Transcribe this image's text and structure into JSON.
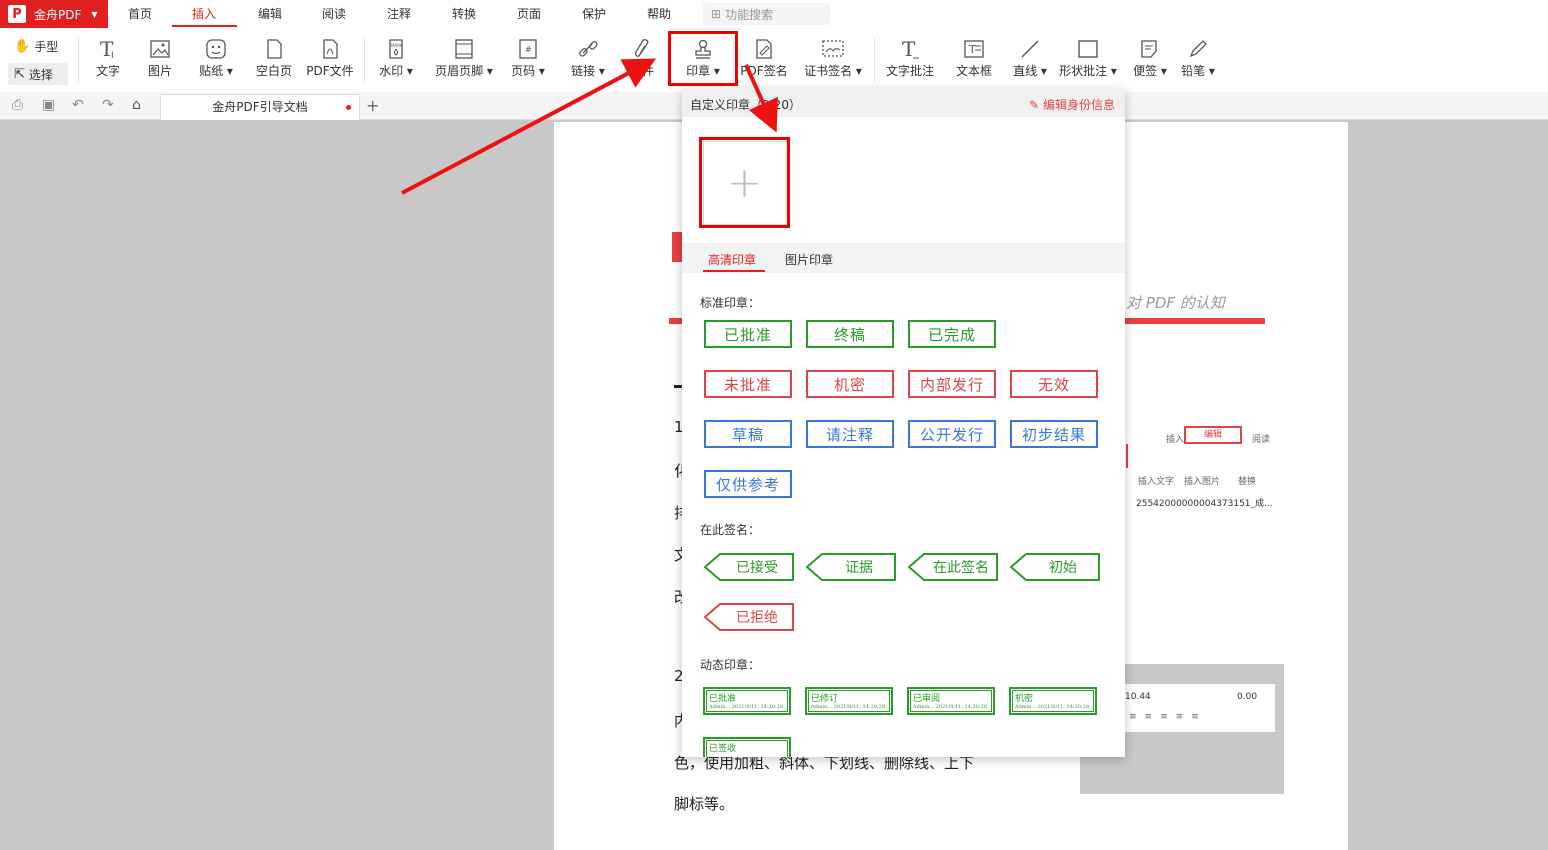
{
  "app": {
    "name": "金舟PDF",
    "logo_letter": "P"
  },
  "menus": [
    "首页",
    "插入",
    "编辑",
    "阅读",
    "注释",
    "转换",
    "页面",
    "保护",
    "帮助"
  ],
  "active_menu": "插入",
  "search": {
    "placeholder": "功能搜索"
  },
  "mode": {
    "hand": "手型",
    "select": "选择"
  },
  "tools": {
    "text": "文字",
    "image": "图片",
    "sticker": "贴纸",
    "blank": "空白页",
    "pdffile": "PDF文件",
    "watermark": "水印",
    "headerfooter": "页眉页脚",
    "pagenum": "页码",
    "link": "链接",
    "attach": "附件",
    "stamp": "印章",
    "pdfsign": "PDF签名",
    "certsign": "证书签名",
    "textnote": "文字批注",
    "textbox": "文本框",
    "line": "直线",
    "shape": "形状批注",
    "note": "便签",
    "pencil": "铅笔"
  },
  "tab": {
    "title": "金舟PDF引导文档"
  },
  "document": {
    "subtitle": "对 PDF 的认知",
    "lines": [
      "1",
      "化",
      "排",
      "文",
      "改",
      "2",
      "内",
      "色，使用加粗、斜体、下划线、删除线、上下",
      "脚标等。"
    ],
    "embed1": {
      "items": [
        "插入",
        "编辑",
        "阅读"
      ],
      "tools": [
        "插入文字",
        "插入图片",
        "替换"
      ],
      "file": "25542000000004373151_成..."
    },
    "embed2": {
      "size": "10.44",
      "spacing": "0.00"
    }
  },
  "stamp_panel": {
    "header": "自定义印章（0/20）",
    "edit_identity": "编辑身份信息",
    "add": "+",
    "tabs": [
      "高清印章",
      "图片印章"
    ],
    "sections": {
      "standard": "标准印章：",
      "signhere": "在此签名：",
      "dynamic": "动态印章："
    },
    "standard": [
      {
        "label": "已批准",
        "color": "#2a9a2a"
      },
      {
        "label": "终稿",
        "color": "#2a9a2a"
      },
      {
        "label": "已完成",
        "color": "#2a9a2a"
      },
      {
        "label": "未批准",
        "color": "#e04545"
      },
      {
        "label": "机密",
        "color": "#e04545"
      },
      {
        "label": "内部发行",
        "color": "#e04545"
      },
      {
        "label": "无效",
        "color": "#e04545"
      },
      {
        "label": "草稿",
        "color": "#3a78d8"
      },
      {
        "label": "请注释",
        "color": "#3a78d8"
      },
      {
        "label": "公开发行",
        "color": "#3a78d8"
      },
      {
        "label": "初步结果",
        "color": "#3a78d8"
      },
      {
        "label": "仅供参考",
        "color": "#3a78d8"
      }
    ],
    "signhere": [
      {
        "label": "已接受",
        "color": "#2a9a2a"
      },
      {
        "label": "证据",
        "color": "#2a9a2a"
      },
      {
        "label": "在此签名",
        "color": "#2a9a2a"
      },
      {
        "label": "初始",
        "color": "#2a9a2a"
      },
      {
        "label": "已拒绝",
        "color": "#e04545"
      }
    ],
    "dynamic": [
      {
        "label": "已批准",
        "sub": "Admin... 2021/8/11, 14:20:28"
      },
      {
        "label": "已修订",
        "sub": "Admin... 2021/8/11, 14:20:28"
      },
      {
        "label": "已审阅",
        "sub": "Admin... 2021/8/11, 14:20:28"
      },
      {
        "label": "机密",
        "sub": "Admin... 2021/8/11, 14:20:28"
      },
      {
        "label": "已签收",
        "sub": ""
      }
    ]
  },
  "colors": {
    "brand": "#e02020",
    "highlight": "#ee0000"
  }
}
